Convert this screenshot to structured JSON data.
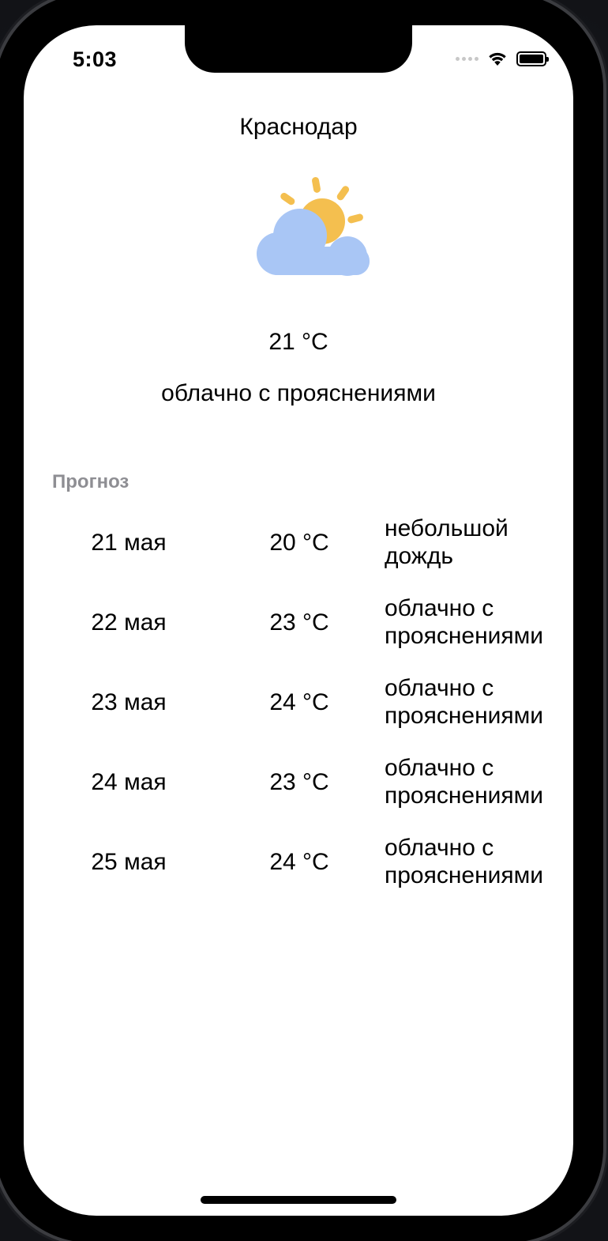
{
  "status_bar": {
    "time": "5:03",
    "icons": [
      "cellular-signal-icon",
      "wifi-icon",
      "battery-icon"
    ]
  },
  "current": {
    "city": "Краснодар",
    "icon": "partly-cloudy-icon",
    "temperature": "21 °C",
    "description": "облачно с прояснениями"
  },
  "forecast": {
    "heading": "Прогноз",
    "items": [
      {
        "date": "21 мая",
        "temp": "20 °C",
        "desc_line1": "небольшой",
        "desc_line2": "дождь"
      },
      {
        "date": "22 мая",
        "temp": "23 °C",
        "desc_line1": "облачно с",
        "desc_line2": "прояснениями"
      },
      {
        "date": "23 мая",
        "temp": "24 °C",
        "desc_line1": "облачно с",
        "desc_line2": "прояснениями"
      },
      {
        "date": "24 мая",
        "temp": "23 °C",
        "desc_line1": "облачно с",
        "desc_line2": "прояснениями"
      },
      {
        "date": "25 мая",
        "temp": "24 °C",
        "desc_line1": "облачно с",
        "desc_line2": "прояснениями"
      }
    ]
  },
  "colors": {
    "sun": "#F4BF4F",
    "cloud": "#A9C6F5",
    "heading_gray": "#8E8E93"
  }
}
